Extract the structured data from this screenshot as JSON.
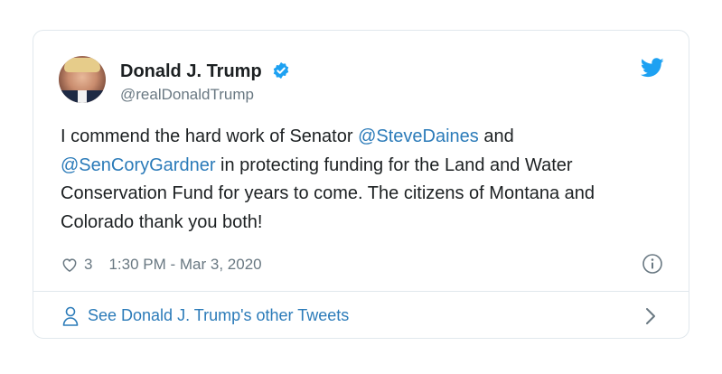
{
  "tweet": {
    "author": {
      "name": "Donald J. Trump",
      "handle": "@realDonaldTrump",
      "verified": true
    },
    "text": {
      "part1": "I commend the hard work of Senator ",
      "mention1": "@SteveDaines",
      "part2": " and ",
      "mention2": "@SenCoryGardner",
      "part3": " in protecting funding for the Land and Water Conservation Fund for years to come. The citizens of Montana and Colorado thank you both!"
    },
    "likes": "3",
    "timestamp": "1:30 PM - Mar 3, 2020"
  },
  "footer": {
    "link_text": "See Donald J. Trump's other Tweets"
  },
  "icons": {
    "brand": "twitter-bird-icon",
    "verified": "verified-badge-icon",
    "like": "heart-icon",
    "info": "info-icon",
    "profile": "person-icon",
    "chevron": "chevron-right-icon"
  },
  "colors": {
    "accent": "#1da1f2",
    "link": "#2b7bb9",
    "text": "#1c2022",
    "muted": "#697882",
    "border": "#e1e8ed"
  }
}
